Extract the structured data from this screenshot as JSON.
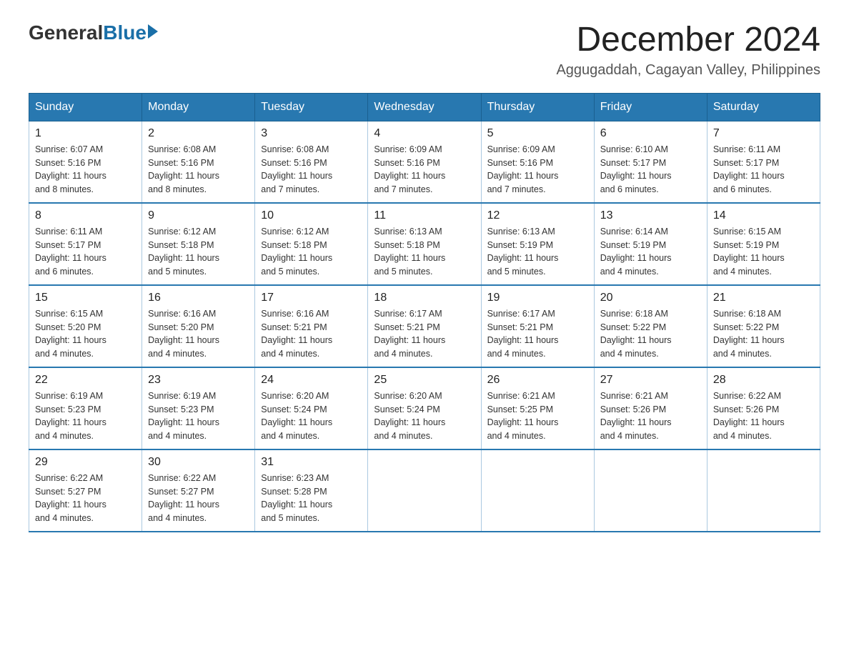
{
  "header": {
    "logo_general": "General",
    "logo_blue": "Blue",
    "month_title": "December 2024",
    "location": "Aggugaddah, Cagayan Valley, Philippines"
  },
  "weekdays": [
    "Sunday",
    "Monday",
    "Tuesday",
    "Wednesday",
    "Thursday",
    "Friday",
    "Saturday"
  ],
  "weeks": [
    [
      {
        "day": "1",
        "sunrise": "6:07 AM",
        "sunset": "5:16 PM",
        "daylight": "11 hours and 8 minutes."
      },
      {
        "day": "2",
        "sunrise": "6:08 AM",
        "sunset": "5:16 PM",
        "daylight": "11 hours and 8 minutes."
      },
      {
        "day": "3",
        "sunrise": "6:08 AM",
        "sunset": "5:16 PM",
        "daylight": "11 hours and 7 minutes."
      },
      {
        "day": "4",
        "sunrise": "6:09 AM",
        "sunset": "5:16 PM",
        "daylight": "11 hours and 7 minutes."
      },
      {
        "day": "5",
        "sunrise": "6:09 AM",
        "sunset": "5:16 PM",
        "daylight": "11 hours and 7 minutes."
      },
      {
        "day": "6",
        "sunrise": "6:10 AM",
        "sunset": "5:17 PM",
        "daylight": "11 hours and 6 minutes."
      },
      {
        "day": "7",
        "sunrise": "6:11 AM",
        "sunset": "5:17 PM",
        "daylight": "11 hours and 6 minutes."
      }
    ],
    [
      {
        "day": "8",
        "sunrise": "6:11 AM",
        "sunset": "5:17 PM",
        "daylight": "11 hours and 6 minutes."
      },
      {
        "day": "9",
        "sunrise": "6:12 AM",
        "sunset": "5:18 PM",
        "daylight": "11 hours and 5 minutes."
      },
      {
        "day": "10",
        "sunrise": "6:12 AM",
        "sunset": "5:18 PM",
        "daylight": "11 hours and 5 minutes."
      },
      {
        "day": "11",
        "sunrise": "6:13 AM",
        "sunset": "5:18 PM",
        "daylight": "11 hours and 5 minutes."
      },
      {
        "day": "12",
        "sunrise": "6:13 AM",
        "sunset": "5:19 PM",
        "daylight": "11 hours and 5 minutes."
      },
      {
        "day": "13",
        "sunrise": "6:14 AM",
        "sunset": "5:19 PM",
        "daylight": "11 hours and 4 minutes."
      },
      {
        "day": "14",
        "sunrise": "6:15 AM",
        "sunset": "5:19 PM",
        "daylight": "11 hours and 4 minutes."
      }
    ],
    [
      {
        "day": "15",
        "sunrise": "6:15 AM",
        "sunset": "5:20 PM",
        "daylight": "11 hours and 4 minutes."
      },
      {
        "day": "16",
        "sunrise": "6:16 AM",
        "sunset": "5:20 PM",
        "daylight": "11 hours and 4 minutes."
      },
      {
        "day": "17",
        "sunrise": "6:16 AM",
        "sunset": "5:21 PM",
        "daylight": "11 hours and 4 minutes."
      },
      {
        "day": "18",
        "sunrise": "6:17 AM",
        "sunset": "5:21 PM",
        "daylight": "11 hours and 4 minutes."
      },
      {
        "day": "19",
        "sunrise": "6:17 AM",
        "sunset": "5:21 PM",
        "daylight": "11 hours and 4 minutes."
      },
      {
        "day": "20",
        "sunrise": "6:18 AM",
        "sunset": "5:22 PM",
        "daylight": "11 hours and 4 minutes."
      },
      {
        "day": "21",
        "sunrise": "6:18 AM",
        "sunset": "5:22 PM",
        "daylight": "11 hours and 4 minutes."
      }
    ],
    [
      {
        "day": "22",
        "sunrise": "6:19 AM",
        "sunset": "5:23 PM",
        "daylight": "11 hours and 4 minutes."
      },
      {
        "day": "23",
        "sunrise": "6:19 AM",
        "sunset": "5:23 PM",
        "daylight": "11 hours and 4 minutes."
      },
      {
        "day": "24",
        "sunrise": "6:20 AM",
        "sunset": "5:24 PM",
        "daylight": "11 hours and 4 minutes."
      },
      {
        "day": "25",
        "sunrise": "6:20 AM",
        "sunset": "5:24 PM",
        "daylight": "11 hours and 4 minutes."
      },
      {
        "day": "26",
        "sunrise": "6:21 AM",
        "sunset": "5:25 PM",
        "daylight": "11 hours and 4 minutes."
      },
      {
        "day": "27",
        "sunrise": "6:21 AM",
        "sunset": "5:26 PM",
        "daylight": "11 hours and 4 minutes."
      },
      {
        "day": "28",
        "sunrise": "6:22 AM",
        "sunset": "5:26 PM",
        "daylight": "11 hours and 4 minutes."
      }
    ],
    [
      {
        "day": "29",
        "sunrise": "6:22 AM",
        "sunset": "5:27 PM",
        "daylight": "11 hours and 4 minutes."
      },
      {
        "day": "30",
        "sunrise": "6:22 AM",
        "sunset": "5:27 PM",
        "daylight": "11 hours and 4 minutes."
      },
      {
        "day": "31",
        "sunrise": "6:23 AM",
        "sunset": "5:28 PM",
        "daylight": "11 hours and 5 minutes."
      },
      null,
      null,
      null,
      null
    ]
  ],
  "labels": {
    "sunrise": "Sunrise:",
    "sunset": "Sunset:",
    "daylight": "Daylight:"
  }
}
